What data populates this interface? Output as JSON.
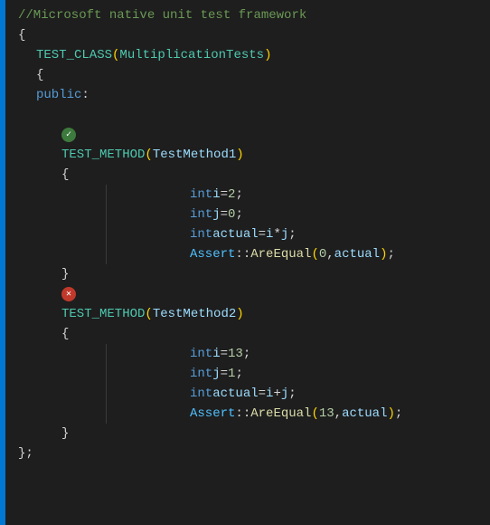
{
  "editor": {
    "comment": "//Microsoft native unit test framework",
    "lines": [
      {
        "id": "comment",
        "text": "//Microsoft native unit test framework",
        "type": "comment"
      },
      {
        "id": "open-brace-0",
        "text": "{",
        "type": "normal",
        "indent": 0
      },
      {
        "id": "test-class",
        "text": "TEST_CLASS",
        "param": "MultiplicationTests",
        "type": "test-class",
        "indent": 1
      },
      {
        "id": "open-brace-1",
        "text": "{",
        "type": "normal",
        "indent": 1
      },
      {
        "id": "public",
        "text": "public:",
        "type": "keyword-public",
        "indent": 1
      },
      {
        "id": "blank-1",
        "text": "",
        "type": "blank"
      },
      {
        "id": "pass-icon",
        "type": "icon-pass"
      },
      {
        "id": "test-method-1",
        "text": "TEST_METHOD",
        "param": "TestMethod1",
        "type": "test-method",
        "indent": 2
      },
      {
        "id": "open-brace-2",
        "text": "{",
        "type": "normal",
        "indent": 2
      },
      {
        "id": "int-i",
        "kw": "int",
        "rest": " i = 2;",
        "type": "int-line",
        "indent": 3
      },
      {
        "id": "int-j",
        "kw": "int",
        "rest": " j = 0;",
        "type": "int-line",
        "indent": 3
      },
      {
        "id": "int-actual-1",
        "kw": "int",
        "rest": " actual = i * j;",
        "type": "int-line",
        "indent": 3
      },
      {
        "id": "assert-1",
        "text": "Assert::AreEqual(0, actual);",
        "type": "assert",
        "indent": 3
      },
      {
        "id": "close-brace-2",
        "text": "}",
        "type": "normal",
        "indent": 2
      },
      {
        "id": "fail-icon",
        "type": "icon-fail"
      },
      {
        "id": "test-method-2",
        "text": "TEST_METHOD",
        "param": "TestMethod2",
        "type": "test-method",
        "indent": 2
      },
      {
        "id": "open-brace-3",
        "text": "{",
        "type": "normal",
        "indent": 2
      },
      {
        "id": "int-i-2",
        "kw": "int",
        "rest": " i = 13;",
        "type": "int-line",
        "indent": 3
      },
      {
        "id": "int-j-2",
        "kw": "int",
        "rest": " j = 1;",
        "type": "int-line",
        "indent": 3
      },
      {
        "id": "int-actual-2",
        "kw": "int",
        "rest": " actual = i + j;",
        "type": "int-line",
        "indent": 3
      },
      {
        "id": "assert-2",
        "text": "Assert::AreEqual(13, actual);",
        "type": "assert",
        "indent": 3
      },
      {
        "id": "close-brace-3",
        "text": "}",
        "type": "normal",
        "indent": 2
      },
      {
        "id": "close-brace-1",
        "text": "};",
        "type": "normal",
        "indent": 0
      }
    ]
  }
}
